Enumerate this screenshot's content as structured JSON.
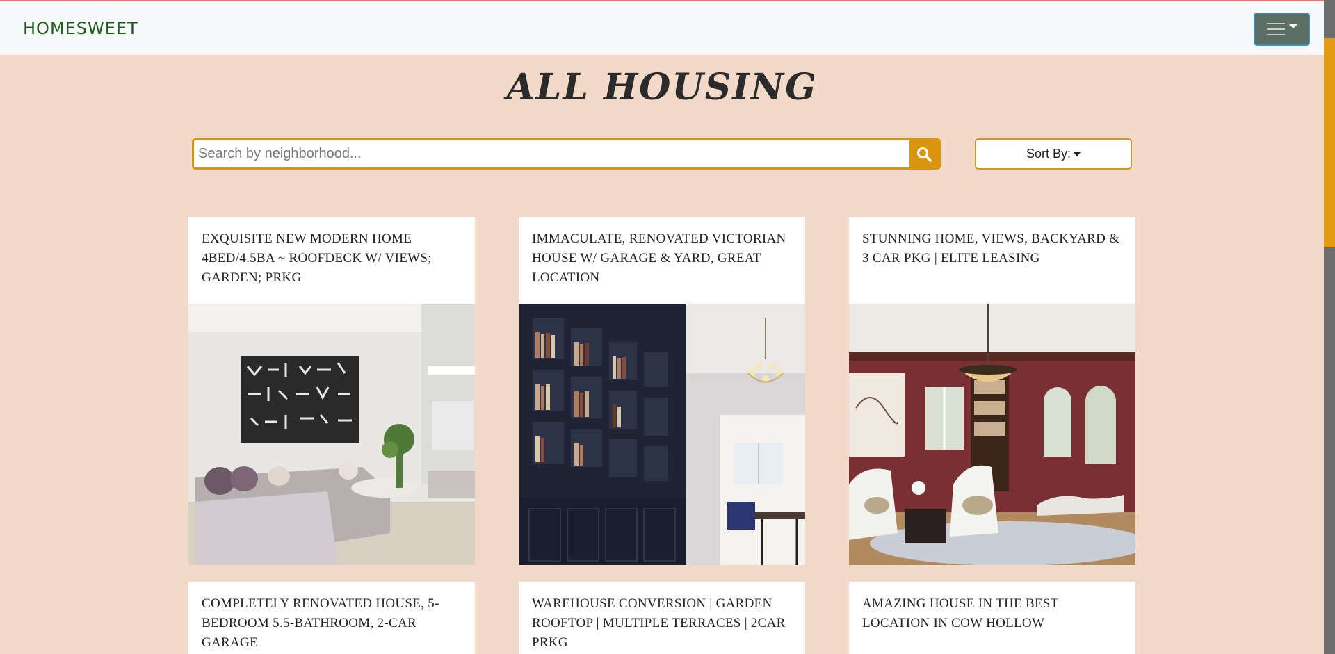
{
  "navbar": {
    "brand": "HOMESWEET",
    "menu_icon": "hamburger-icon"
  },
  "page": {
    "title": "ALL HOUSING"
  },
  "search": {
    "placeholder": "Search by neighborhood...",
    "value": "",
    "icon": "search-icon"
  },
  "sort": {
    "label": "Sort By:"
  },
  "colors": {
    "background": "#f2d9c8",
    "accent": "#d9950e",
    "brand": "#1f5b1f",
    "menu_button": "#5b6e63"
  },
  "listings": [
    {
      "title": "EXQUISITE NEW MODERN HOME 4BED/4.5BA ~ ROOFDECK W/ VIEWS; GARDEN; PRKG",
      "image": "modern-living-room-photo"
    },
    {
      "title": "IMMACULATE, RENOVATED VICTORIAN HOUSE W/ GARAGE & YARD, GREAT LOCATION",
      "image": "library-bookshelf-photo"
    },
    {
      "title": "STUNNING HOME, VIEWS, BACKYARD & 3 CAR PKG | ELITE LEASING",
      "image": "red-sitting-room-photo"
    },
    {
      "title": "COMPLETELY RENOVATED HOUSE, 5-BEDROOM 5.5-BATHROOM, 2-CAR GARAGE",
      "image": ""
    },
    {
      "title": "WAREHOUSE CONVERSION | GARDEN ROOFTOP | MULTIPLE TERRACES | 2CAR PRKG",
      "image": ""
    },
    {
      "title": "AMAZING HOUSE IN THE BEST LOCATION IN COW HOLLOW",
      "image": ""
    }
  ]
}
